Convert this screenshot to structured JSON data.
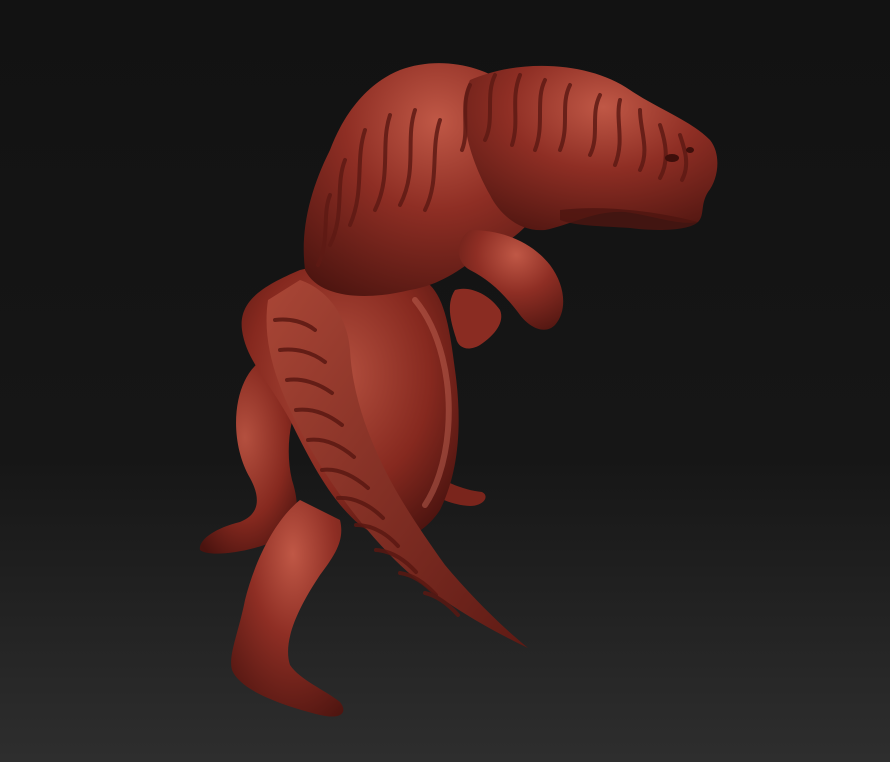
{
  "scene": {
    "subject_icon": "sculpted-creature-icon",
    "colors": {
      "background_top": "#121212",
      "background_bottom": "#2c2c2c",
      "material_base": "#8a2c22",
      "material_light": "#c25a48",
      "material_shadow": "#4a130f",
      "stripe_color": "#6a1e17"
    }
  }
}
